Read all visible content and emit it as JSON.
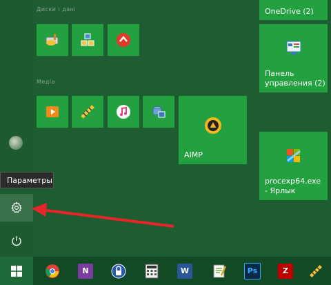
{
  "groups": [
    {
      "label": "Диски і дані"
    },
    {
      "label": "Медіа"
    }
  ],
  "tiles": {
    "onedrive": {
      "label": "OneDrive (2)"
    },
    "control_panel": {
      "label_line1": "Панель",
      "label_line2": "управления (2)"
    },
    "aimp": {
      "label": "AIMP"
    },
    "procexp": {
      "label_line1": "procexp64.exe",
      "label_line2": "- Ярлык"
    }
  },
  "tooltip": {
    "text": "Параметры"
  },
  "colors": {
    "tile": "#23a040",
    "background": "#1e5c32",
    "taskbar": "#124a26",
    "arrow": "#e8262a"
  },
  "taskbar": {
    "items": [
      "start-icon",
      "chrome-icon",
      "onenote-icon",
      "keepass-icon",
      "calculator-icon",
      "word-icon",
      "notepadpp-icon",
      "photoshop-icon",
      "filezilla-icon",
      "tool-icon"
    ]
  }
}
